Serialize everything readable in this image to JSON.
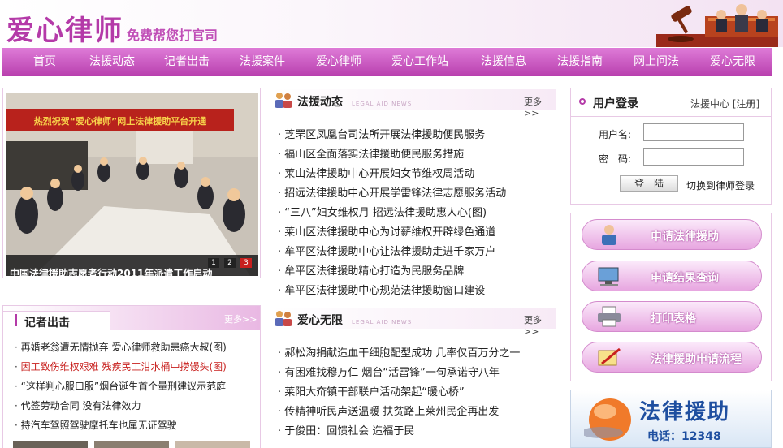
{
  "header": {
    "logo_main": "爱心律师",
    "logo_sub": "免费帮您打官司"
  },
  "nav": {
    "items": [
      "首页",
      "法援动态",
      "记者出击",
      "法援案件",
      "爱心律师",
      "爱心工作站",
      "法援信息",
      "法援指南",
      "网上问法",
      "爱心无限"
    ]
  },
  "slideshow": {
    "banner_text": "热烈祝贺“爱心律师”网上法律援助平台开通",
    "caption": "中国法律援助志愿者行动2011年派遣工作启动",
    "pages": [
      "1",
      "2",
      "3"
    ]
  },
  "legal_news": {
    "title": "法援动态",
    "en": "LEGAL AID NEWS",
    "more": "更多>>",
    "items": [
      "芝罘区凤凰台司法所开展法律援助便民服务",
      "福山区全面落实法律援助便民服务措施",
      "莱山法律援助中心开展妇女节维权周活动",
      "招远法律援助中心开展学雷锋法律志愿服务活动",
      "“三八”妇女维权月 招远法律援助惠人心(图)",
      "莱山区法律援助中心为讨薪维权开辟绿色通道",
      "牟平区法律援助中心让法律援助走进千家万户",
      "牟平区法律援助精心打造为民服务品牌",
      "牟平区法律援助中心规范法律援助窗口建设"
    ]
  },
  "love": {
    "title": "爱心无限",
    "en": "LEGAL AID NEWS",
    "more": "更多>>",
    "items": [
      "郝松淘捐献造血干细胞配型成功 几率仅百万分之一",
      "有困难找穆万仁 烟台“活雷锋”一句承诺守八年",
      "莱阳大夼镇干部联户活动架起“暖心桥”",
      "传精神听民声送温暖 扶贫路上莱州民企再出发",
      "于俊田：回馈社会 造福于民"
    ]
  },
  "reporter": {
    "title": "记者出击",
    "more": "更多>>",
    "items": [
      {
        "text": "再婚老翁遭无情抛弃 爱心律师救助患癌大叔(图)",
        "red": false
      },
      {
        "text": "因工致伤维权艰难 残疾民工泔水桶中捞馒头(图)",
        "red": true
      },
      {
        "text": "“这样判心服口服”烟台诞生首个量刑建议示范庭",
        "red": false
      },
      {
        "text": "代签劳动合同 没有法律效力",
        "red": false
      },
      {
        "text": "持汽车驾照驾驶摩托车也属无证驾驶",
        "red": false
      }
    ]
  },
  "login": {
    "title": "用户登录",
    "links": "法援中心 [注册]",
    "username_label": "用户名:",
    "password_label": "密　码:",
    "login_button": "登　陆",
    "switch_link": "切换到律师登录"
  },
  "side_buttons": [
    "申请法律援助",
    "申请结果查询",
    "打印表格",
    "法律援助申请流程"
  ],
  "banner": {
    "title": "法律援助",
    "phone": "电话：12348"
  }
}
